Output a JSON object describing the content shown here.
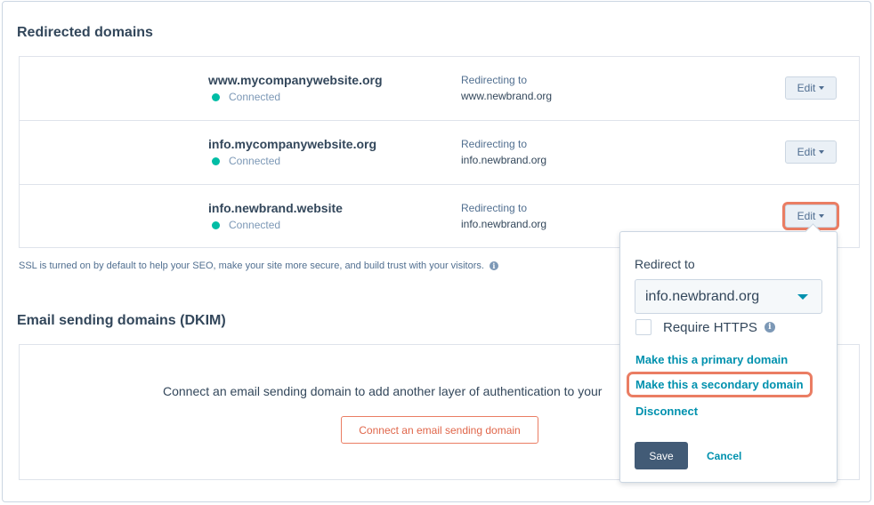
{
  "redirected_domains": {
    "title": "Redirected domains",
    "rows": [
      {
        "domain": "www.mycompanywebsite.org",
        "status": "Connected",
        "redirect_label": "Redirecting to",
        "redirect_target": "www.newbrand.org",
        "edit_label": "Edit"
      },
      {
        "domain": "info.mycompanywebsite.org",
        "status": "Connected",
        "redirect_label": "Redirecting to",
        "redirect_target": "info.newbrand.org",
        "edit_label": "Edit"
      },
      {
        "domain": "info.newbrand.website",
        "status": "Connected",
        "redirect_label": "Redirecting to",
        "redirect_target": "info.newbrand.org",
        "edit_label": "Edit"
      }
    ],
    "ssl_note": "SSL is turned on by default to help your SEO, make your site more secure, and build trust with your visitors."
  },
  "email_domains": {
    "title": "Email sending domains (DKIM)",
    "message": "Connect an email sending domain to add another layer of authentication to your",
    "connect_button": "Connect an email sending domain"
  },
  "popover": {
    "redirect_label": "Redirect to",
    "selected_value": "info.newbrand.org",
    "require_https_label": "Require HTTPS",
    "require_https_checked": false,
    "make_primary": "Make this a primary domain",
    "make_secondary": "Make this a secondary domain",
    "disconnect": "Disconnect",
    "save": "Save",
    "cancel": "Cancel"
  },
  "colors": {
    "connected": "#00bda5",
    "link": "#0091ae",
    "highlight": "#ea7d63",
    "save_button": "#425b76"
  }
}
